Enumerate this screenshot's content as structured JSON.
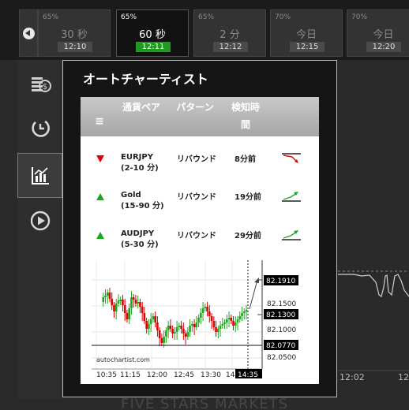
{
  "expiries": [
    {
      "pct": "65%",
      "label": "30 秒",
      "time": "12:10",
      "active": false
    },
    {
      "pct": "65%",
      "label": "60 秒",
      "time": "12:11",
      "active": true
    },
    {
      "pct": "65%",
      "label": "2 分",
      "time": "12:12",
      "active": false
    },
    {
      "pct": "70%",
      "label": "今日",
      "time": "12:15",
      "active": false
    },
    {
      "pct": "70%",
      "label": "今日",
      "time": "12:20",
      "active": false
    }
  ],
  "panel": {
    "title": "オートチャーティスト",
    "headers": {
      "menu": "≡",
      "pattern_col": "通貨ペア",
      "type_col": "パターン",
      "detect_col": "検知時間"
    },
    "rows": [
      {
        "direction": "down",
        "instrument": "EURJPY",
        "period": "(2-10 分)",
        "pattern": "リバウンド",
        "age": "8分前"
      },
      {
        "direction": "up",
        "instrument": "Gold",
        "period": "(15-90 分)",
        "pattern": "リバウンド",
        "age": "19分前"
      },
      {
        "direction": "up",
        "instrument": "AUDJPY",
        "period": "(5-30 分)",
        "pattern": "リバウンド",
        "age": "29分前"
      }
    ]
  },
  "chart_data": {
    "type": "candlestick",
    "x_ticks": [
      "10:35",
      "11:15",
      "12:00",
      "12:45",
      "13:30",
      "14"
    ],
    "current_time": "14:35",
    "y_ticks": [
      "82.1500",
      "82.1000",
      "82.0500"
    ],
    "y_range": [
      82.04,
      82.22
    ],
    "levels": [
      {
        "value": "82.1910",
        "num": 82.191,
        "highlight": true
      },
      {
        "value": "82.1300",
        "num": 82.13,
        "highlight": true
      },
      {
        "value": "82.0770",
        "num": 82.077,
        "highlight": true
      }
    ],
    "watermark": "autochartist.com"
  },
  "background": {
    "x_labels": [
      "12:02",
      "12:"
    ]
  },
  "brand": "FIVE STARS MARKETS",
  "colors": {
    "up": "#1ea81e",
    "down": "#e00000",
    "active_time": "#1e9a1e"
  }
}
